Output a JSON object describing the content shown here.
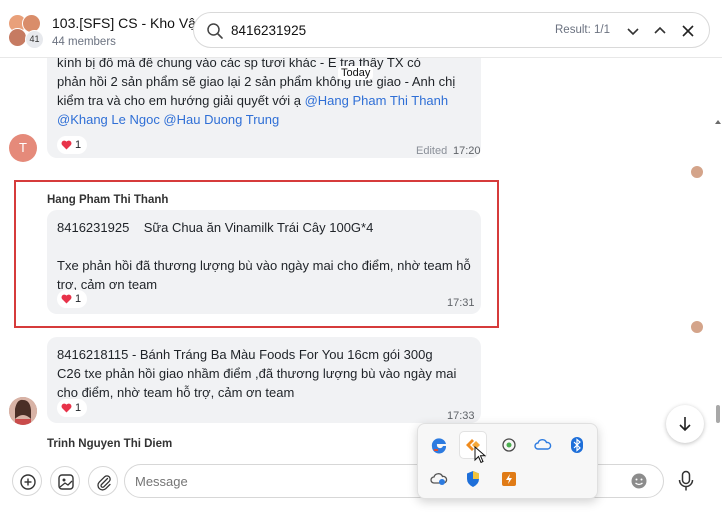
{
  "header": {
    "group_name": "103.[SFS] CS - Kho Vận",
    "members": "44 members",
    "avatar_count": "41"
  },
  "search": {
    "query": "8416231925",
    "result": "Result: 1/1"
  },
  "messages": [
    {
      "line1": "kính bị đổ mà để chung vào các sp tươi khác - E",
      "line1b": " tra thấy TX có",
      "line2": "phản hồi 2 sản phẩm sẽ giao lại 2 sản phẩm không thể giao - Anh chị",
      "line3": "kiểm tra và cho em hướng giải quyết với ạ ",
      "mention1": "@Hang Pham Thi Thanh",
      "mention2": "@Khang Le Ngoc @Hau Duong Trung",
      "reaction": "1",
      "edited": "Edited",
      "time": "17:20",
      "avatar_letter": "T"
    },
    {
      "sender": "Hang Pham Thi Thanh",
      "line1": "8416231925    Sữa Chua ăn Vinamilk Trái Cây 100G*4",
      "line2": "Txe phản hồi đã thương lượng bù vào ngày mai cho điểm, nhờ team hỗ",
      "line3": "trợ, cảm ơn team",
      "reaction": "1",
      "time": "17:31"
    },
    {
      "line1": "8416218115 - Bánh Tráng Ba Màu Foods For You 16cm gói 300g",
      "line2": "C26 txe phản hồi giao nhầm điểm ,đã thương lượng bù vào ngày mai",
      "line3": "cho điểm, nhờ team hỗ trợ, cảm ơn team",
      "reaction": "1",
      "time": "17:33"
    },
    {
      "sender": "Trinh Nguyen Thi Diem"
    }
  ],
  "date_divider": "Today",
  "composer": {
    "placeholder": "Message"
  },
  "tray_icons": [
    "edge-icon",
    "app-icon",
    "touch-icon",
    "onedrive-icon",
    "bluetooth-icon",
    "cloud-sync-icon",
    "security-icon",
    "power-app-icon"
  ],
  "colors": {
    "mention": "#2f6fd6",
    "highlight_border": "#d63b3b",
    "bubble": "#f1f2f4",
    "heart": "#e8334a"
  }
}
